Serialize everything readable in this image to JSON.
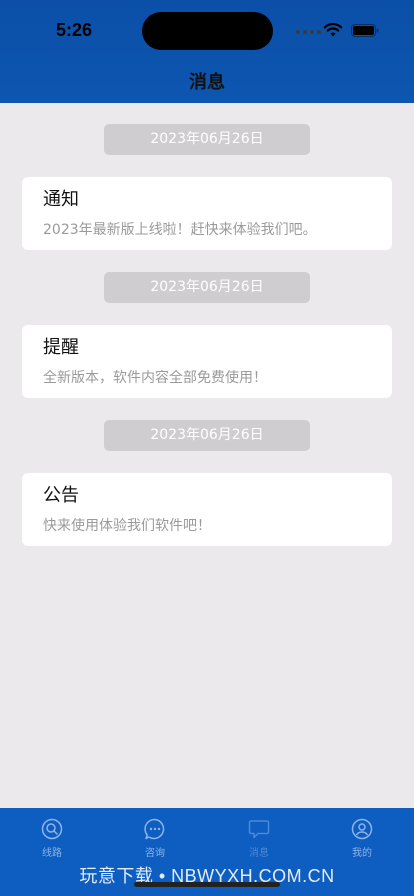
{
  "status_bar": {
    "time": "5:26"
  },
  "header": {
    "title": "消息"
  },
  "messages": [
    {
      "date": "2023年06月26日",
      "title": "通知",
      "body": "2023年最新版上线啦！赶快来体验我们吧。"
    },
    {
      "date": "2023年06月26日",
      "title": "提醒",
      "body": "全新版本，软件内容全部免费使用！"
    },
    {
      "date": "2023年06月26日",
      "title": "公告",
      "body": "快来使用体验我们软件吧！"
    }
  ],
  "tabbar": {
    "tabs": [
      {
        "label": "线路",
        "icon": "search-icon"
      },
      {
        "label": "咨询",
        "icon": "chat-icon"
      },
      {
        "label": "消息",
        "icon": "message-icon"
      },
      {
        "label": "我的",
        "icon": "user-icon"
      }
    ]
  },
  "watermark": "玩意下载 • NBWYXH.COM.CN",
  "colors": {
    "header": "#0b4fa8",
    "tabbar": "#0d5ec0",
    "background": "#ebe9ec",
    "date_pill": "#cfcdcf"
  }
}
